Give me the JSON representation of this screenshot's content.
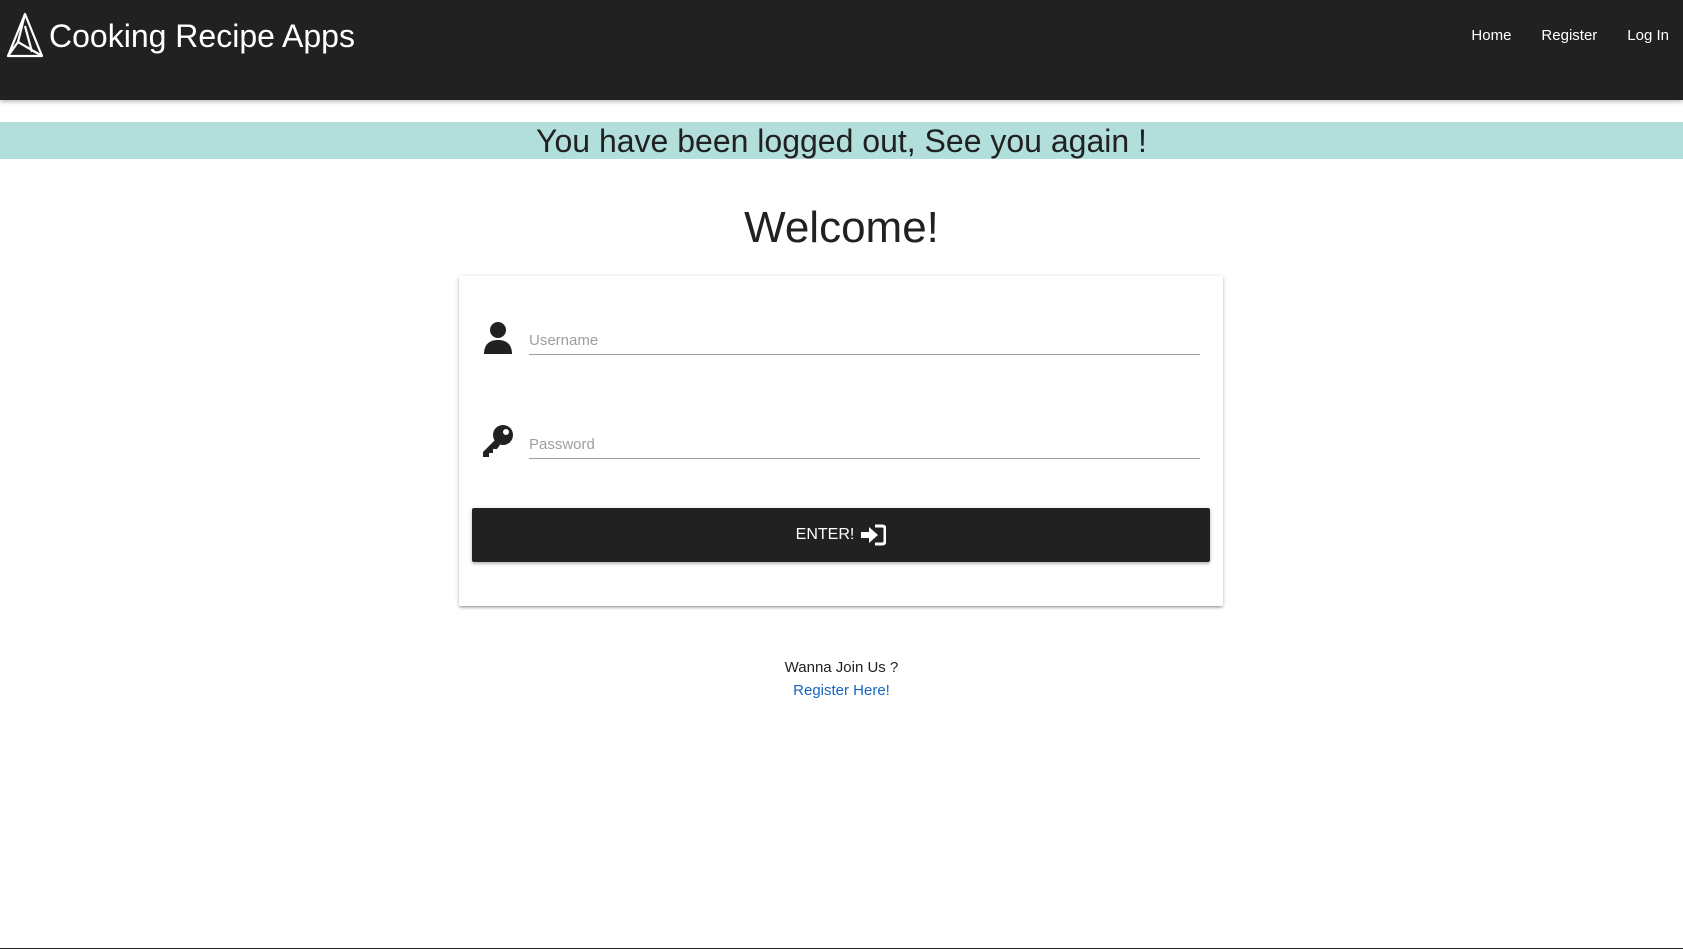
{
  "header": {
    "brand_title": "Cooking Recipe Apps",
    "nav": {
      "home": "Home",
      "register": "Register",
      "login": "Log In"
    }
  },
  "flash": {
    "message": "You have been logged out, See you again !"
  },
  "main": {
    "heading": "Welcome!",
    "form": {
      "username_placeholder": "Username",
      "username_value": "",
      "password_placeholder": "Password",
      "password_value": "",
      "submit_label": "ENTER!"
    },
    "join": {
      "prompt": "Wanna Join Us ?",
      "link": "Register Here!"
    }
  },
  "colors": {
    "navbar": "#212121",
    "flash_background": "#b2dfdb",
    "button": "#212121",
    "link": "#1565c0"
  },
  "icons": {
    "brand": "triangle-logo-icon",
    "username": "user-icon",
    "password": "key-icon",
    "submit": "sign-in-icon"
  }
}
